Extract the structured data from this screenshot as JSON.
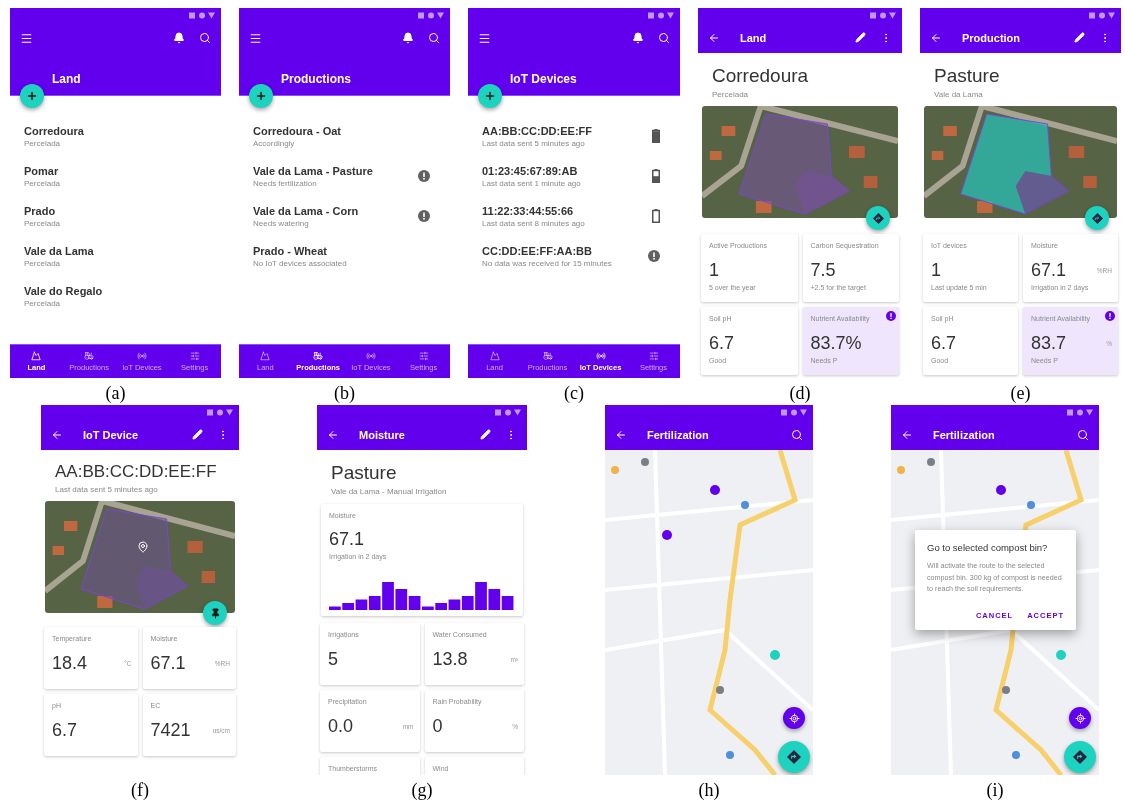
{
  "figures": [
    {
      "caption": "(a)",
      "screen": {
        "kind": "list",
        "title": "Land",
        "items": [
          {
            "title": "Corredoura",
            "subtitle": "Percelada",
            "kind": "plain"
          },
          {
            "title": "Pomar",
            "subtitle": "Percelada",
            "kind": "plain"
          },
          {
            "title": "Prado",
            "subtitle": "Percelada",
            "kind": "plain"
          },
          {
            "title": "Vale da Lama",
            "subtitle": "Percelada",
            "kind": "plain"
          },
          {
            "title": "Vale do Regalo",
            "subtitle": "Percelada",
            "kind": "plain"
          }
        ],
        "nav": [
          {
            "label": "Land",
            "selected": true
          },
          {
            "label": "Productions",
            "selected": false
          },
          {
            "label": "IoT Devices",
            "selected": false
          },
          {
            "label": "Settings",
            "selected": false
          }
        ]
      }
    },
    {
      "caption": "(b)",
      "screen": {
        "kind": "list",
        "title": "Productions",
        "items": [
          {
            "title": "Corredoura - Oat",
            "subtitle": "Accordingly",
            "kind": "plain"
          },
          {
            "title": "Vale da Lama - Pasture",
            "subtitle": "Needs fertilization",
            "kind": "alert"
          },
          {
            "title": "Vale da Lama - Corn",
            "subtitle": "Needs watering",
            "kind": "alert"
          },
          {
            "title": "Prado - Wheat",
            "subtitle": "No IoT devices associated",
            "kind": "plain"
          }
        ],
        "nav": [
          {
            "label": "Land",
            "selected": false
          },
          {
            "label": "Productions",
            "selected": true
          },
          {
            "label": "IoT Devices",
            "selected": false
          },
          {
            "label": "Settings",
            "selected": false
          }
        ]
      }
    },
    {
      "caption": "(c)",
      "screen": {
        "kind": "list",
        "title": "IoT Devices",
        "items": [
          {
            "title": "AA:BB:CC:DD:EE:FF",
            "subtitle": "Last data sent 5 minutes ago",
            "kind": "full"
          },
          {
            "title": "01:23:45:67:89:AB",
            "subtitle": "Last data sent 1 minute ago",
            "kind": "half"
          },
          {
            "title": "11:22:33:44:55:66",
            "subtitle": "Last data sent 8 minutes ago",
            "kind": "empty"
          },
          {
            "title": "CC:DD:EE:FF:AA:BB",
            "subtitle": "No data was received for 15 minutes",
            "kind": "alert"
          }
        ],
        "nav": [
          {
            "label": "Land",
            "selected": false
          },
          {
            "label": "Productions",
            "selected": false
          },
          {
            "label": "IoT Devices",
            "selected": true
          },
          {
            "label": "Settings",
            "selected": false
          }
        ]
      }
    },
    {
      "caption": "(d)",
      "screen": {
        "kind": "land",
        "title": "Land",
        "heading": "Corredoura",
        "subheading": "Percelada",
        "cards": [
          {
            "label": "Active Productions",
            "value": "1",
            "note": "5 over the year",
            "highlighted": false,
            "alert": false
          },
          {
            "label": "Carbon Sequestration",
            "value": "7.5",
            "note": "+2.5 for the target",
            "highlighted": false,
            "alert": false
          },
          {
            "label": "Soil pH",
            "value": "6.7",
            "note": "Good",
            "highlighted": false,
            "alert": false
          },
          {
            "label": "Nutrient Availability",
            "value": "83.7%",
            "note": "Needs P",
            "highlighted": true,
            "alert": true
          }
        ]
      }
    },
    {
      "caption": "(e)",
      "screen": {
        "kind": "production",
        "title": "Production",
        "heading": "Pasture",
        "subheading": "Vale da Lama",
        "cards": [
          {
            "label": "IoT devices",
            "value": "1",
            "note": "Last update 5 min",
            "highlighted": false,
            "alert": false
          },
          {
            "label": "Moisture",
            "value": "67.1",
            "unit": "%RH",
            "note": "Irrigation in 2 days",
            "highlighted": false,
            "alert": false
          },
          {
            "label": "Soil pH",
            "value": "6.7",
            "note": "Good",
            "highlighted": false,
            "alert": false
          },
          {
            "label": "Nutrient Availability",
            "value": "83.7",
            "unit": "%",
            "note": "Needs P",
            "highlighted": true,
            "alert": true
          }
        ]
      }
    },
    {
      "caption": "(f)",
      "screen": {
        "kind": "device",
        "title": "IoT Device",
        "heading": "AA:BB:CC:DD:EE:FF",
        "subheading": "Last data sent 5 minutes ago",
        "cards": [
          {
            "label": "Temperature",
            "value": "18.4",
            "unit": "°C",
            "highlighted": false,
            "alert": false
          },
          {
            "label": "Moisture",
            "value": "67.1",
            "unit": "%RH",
            "highlighted": false,
            "alert": false
          },
          {
            "label": "pH",
            "value": "6.7",
            "highlighted": false,
            "alert": false
          },
          {
            "label": "EC",
            "value": "7421",
            "unit": "us/cm",
            "highlighted": false,
            "alert": false
          }
        ]
      }
    },
    {
      "caption": "(g)",
      "screen": {
        "kind": "trend",
        "title": "Moisture",
        "heading": "Pasture",
        "subheading": "Vale da Lama - Manual Irrigation",
        "trend": {
          "label": "Moisture",
          "value": "67.1",
          "note": "Irrigation in 2 days"
        },
        "cards": [
          {
            "label": "Irrigations",
            "value": "5"
          },
          {
            "label": "Water Consumed",
            "value": "13.8",
            "unit": "m³"
          },
          {
            "label": "Precipitation",
            "value": "0.0",
            "unit": "mm"
          },
          {
            "label": "Rain Probability",
            "value": "0",
            "unit": "%"
          },
          {
            "label": "Thumberstorms"
          },
          {
            "label": "Wind"
          }
        ]
      }
    },
    {
      "caption": "(h)",
      "screen": {
        "kind": "map",
        "title": "Fertilization"
      }
    },
    {
      "caption": "(i)",
      "screen": {
        "kind": "map",
        "title": "Fertilization",
        "dialog": {
          "title": "Go to selected compost bin?",
          "body": "Will activate the route to the selected compost bin. 300 kg of compost is needed to reach the soil requirements.",
          "buttons": [
            "CANCEL",
            "ACCEPT"
          ]
        }
      }
    }
  ]
}
